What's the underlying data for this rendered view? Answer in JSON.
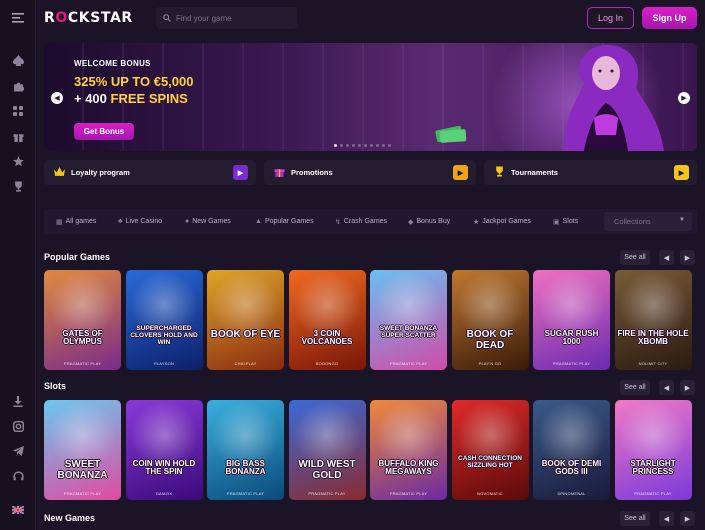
{
  "brand": {
    "logo_pre": "R",
    "logo_o": "O",
    "logo_post": "CKSTAR",
    "accent": "#d91fc6",
    "pink": "#e4157f"
  },
  "header": {
    "search_placeholder": "Find your game",
    "login_label": "Log In",
    "signup_label": "Sign Up"
  },
  "sidebar": {
    "top_icons": [
      "menu-icon",
      "spade-icon",
      "puzzle-icon",
      "grid-icon",
      "gift-icon",
      "star-icon",
      "trophy-icon"
    ],
    "bottom_icons": [
      "download-icon",
      "instagram-icon",
      "telegram-icon",
      "headset-icon",
      "uk-flag-icon"
    ]
  },
  "banner": {
    "title": "WELCOME BONUS",
    "line1": "325% UP TO €5,000",
    "line2_plus": "+ 400",
    "line2_rest": "FREE SPINS",
    "button": "Get Bonus",
    "dots": 10,
    "active_dot": 0
  },
  "promos": [
    {
      "label": "Loyalty program",
      "icon": "crown-icon",
      "arrow_color": "#7b2bd0"
    },
    {
      "label": "Promotions",
      "icon": "gift-icon",
      "arrow_color": "#f0a21a"
    },
    {
      "label": "Tournaments",
      "icon": "trophy-icon",
      "arrow_color": "#f5c518"
    }
  ],
  "categories": [
    {
      "label": "All games",
      "icon": "grid-icon"
    },
    {
      "label": "Live Casino",
      "icon": "cards-icon"
    },
    {
      "label": "New Games",
      "icon": "new-icon"
    },
    {
      "label": "Popular Games",
      "icon": "fire-icon"
    },
    {
      "label": "Crash Games",
      "icon": "bolt-icon"
    },
    {
      "label": "Bonus Buy",
      "icon": "diamond-icon"
    },
    {
      "label": "Jackpot Games",
      "icon": "jackpot-icon"
    },
    {
      "label": "Slots",
      "icon": "slots-icon"
    }
  ],
  "collections_label": "Collections",
  "sections": [
    {
      "title": "Popular Games",
      "see_all": "See all",
      "games": [
        {
          "name": "GATES OF OLYMPUS",
          "provider": "PRAGMATIC PLAY",
          "bg": [
            "#e08a3c",
            "#7a2a8a"
          ]
        },
        {
          "name": "SUPERCHARGED CLOVERS HOLD AND WIN",
          "provider": "PLAYSON",
          "bg": [
            "#2a6ad8",
            "#0d1f6b"
          ]
        },
        {
          "name": "BOOK OF EYE",
          "provider": "CHILIPLAY",
          "bg": [
            "#e0a52a",
            "#8a2a10"
          ]
        },
        {
          "name": "3 COIN VOLCANOES",
          "provider": "BOOONGO",
          "bg": [
            "#f06a20",
            "#7a1508"
          ]
        },
        {
          "name": "SWEET BONANZA SUPER SCATTER",
          "provider": "PRAGMATIC PLAY",
          "bg": [
            "#6ac0ef",
            "#d04aa8"
          ]
        },
        {
          "name": "BOOK OF DEAD",
          "provider": "PLAY'N GO",
          "bg": [
            "#c07830",
            "#3a1a0a"
          ]
        },
        {
          "name": "SUGAR RUSH 1000",
          "provider": "PRAGMATIC PLAY",
          "bg": [
            "#f070c0",
            "#6a2ab0"
          ]
        },
        {
          "name": "FIRE IN THE HOLE XBOMB",
          "provider": "NOLIMIT CITY",
          "bg": [
            "#7a5a3a",
            "#2a1a10"
          ]
        }
      ]
    },
    {
      "title": "Slots",
      "see_all": "See all",
      "games": [
        {
          "name": "SWEET BONANZA",
          "provider": "PRAGMATIC PLAY",
          "bg": [
            "#6ac8f0",
            "#e04aa0"
          ]
        },
        {
          "name": "COIN WIN HOLD THE SPIN",
          "provider": "GAMZIX",
          "bg": [
            "#8a3ad8",
            "#3a0a7a"
          ]
        },
        {
          "name": "BIG BASS BONANZA",
          "provider": "PRAGMATIC PLAY",
          "bg": [
            "#3ab0e0",
            "#0a4a7a"
          ]
        },
        {
          "name": "WILD WEST GOLD",
          "provider": "PRAGMATIC PLAY",
          "bg": [
            "#3a6ad8",
            "#8a2a30"
          ]
        },
        {
          "name": "BUFFALO KING MEGAWAYS",
          "provider": "PRAGMATIC PLAY",
          "bg": [
            "#f08a3a",
            "#6a2aa0"
          ]
        },
        {
          "name": "CASH CONNECTION SIZZLING HOT",
          "provider": "NOVOMATIC",
          "bg": [
            "#e02a2a",
            "#5a0a0a"
          ]
        },
        {
          "name": "BOOK OF DEMI GODS III",
          "provider": "SPINOMENAL",
          "bg": [
            "#3a5a8a",
            "#1a1a3a"
          ]
        },
        {
          "name": "STARLIGHT PRINCESS",
          "provider": "PRAGMATIC PLAY",
          "bg": [
            "#f07ac8",
            "#7a3ad8"
          ]
        }
      ]
    },
    {
      "title": "New Games",
      "see_all": "See all",
      "games": []
    }
  ]
}
